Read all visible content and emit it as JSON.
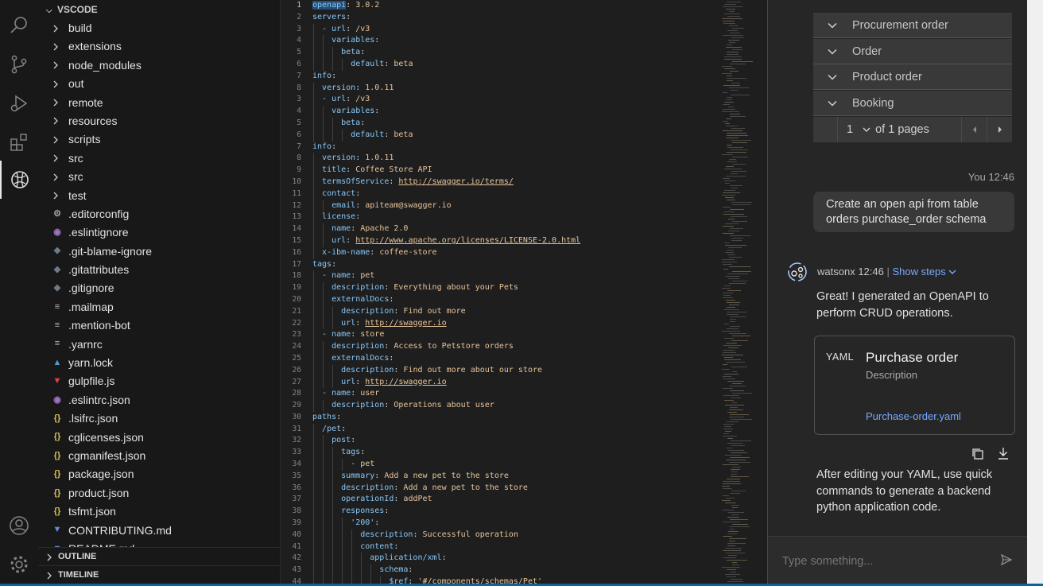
{
  "explorer": {
    "root_label": "VSCODE",
    "items": [
      {
        "type": "folder",
        "label": "build"
      },
      {
        "type": "folder",
        "label": "extensions"
      },
      {
        "type": "folder",
        "label": "node_modules"
      },
      {
        "type": "folder",
        "label": "out"
      },
      {
        "type": "folder",
        "label": "remote"
      },
      {
        "type": "folder",
        "label": "resources"
      },
      {
        "type": "folder",
        "label": "scripts"
      },
      {
        "type": "folder",
        "label": "src"
      },
      {
        "type": "folder",
        "label": "src"
      },
      {
        "type": "folder",
        "label": "test"
      },
      {
        "type": "file",
        "icon": "gear-icon",
        "color": "#9aa0a6",
        "glyph": "⚙",
        "label": ".editorconfig"
      },
      {
        "type": "file",
        "icon": "eslint-icon",
        "color": "#a074c4",
        "glyph": "◉",
        "label": ".eslintignore"
      },
      {
        "type": "file",
        "icon": "git-icon",
        "color": "#6d7a8a",
        "glyph": "◆",
        "label": ".git-blame-ignore"
      },
      {
        "type": "file",
        "icon": "git-icon",
        "color": "#6d7a8a",
        "glyph": "◆",
        "label": ".gitattributes"
      },
      {
        "type": "file",
        "icon": "git-icon",
        "color": "#6d7a8a",
        "glyph": "◆",
        "label": ".gitignore"
      },
      {
        "type": "file",
        "icon": "lines-icon",
        "color": "#aeb4bc",
        "glyph": "≡",
        "label": ".mailmap"
      },
      {
        "type": "file",
        "icon": "lines-icon",
        "color": "#aeb4bc",
        "glyph": "≡",
        "label": ".mention-bot"
      },
      {
        "type": "file",
        "icon": "lines-icon",
        "color": "#aeb4bc",
        "glyph": "≡",
        "label": ".yarnrc"
      },
      {
        "type": "file",
        "icon": "yarn-icon",
        "color": "#4b9fd6",
        "glyph": "▲",
        "label": "yarn.lock"
      },
      {
        "type": "file",
        "icon": "gulp-icon",
        "color": "#e0443e",
        "glyph": "▼",
        "label": "gulpfile.js"
      },
      {
        "type": "file",
        "icon": "eslint-icon",
        "color": "#a074c4",
        "glyph": "◉",
        "label": ".eslintrc.json"
      },
      {
        "type": "file",
        "icon": "json-icon",
        "color": "#d8c05a",
        "glyph": "{}",
        "label": ".lsifrc.json"
      },
      {
        "type": "file",
        "icon": "json-icon",
        "color": "#d8c05a",
        "glyph": "{}",
        "label": "cglicenses.json"
      },
      {
        "type": "file",
        "icon": "json-icon",
        "color": "#d8c05a",
        "glyph": "{}",
        "label": "cgmanifest.json"
      },
      {
        "type": "file",
        "icon": "json-icon",
        "color": "#d8c05a",
        "glyph": "{}",
        "label": "package.json"
      },
      {
        "type": "file",
        "icon": "json-icon",
        "color": "#d8c05a",
        "glyph": "{}",
        "label": "product.json"
      },
      {
        "type": "file",
        "icon": "json-icon",
        "color": "#d8c05a",
        "glyph": "{}",
        "label": "tsfmt.json"
      },
      {
        "type": "file",
        "icon": "markdown-icon",
        "color": "#6a8ad6",
        "glyph": "▼",
        "label": "CONTRIBUTING.md"
      },
      {
        "type": "file",
        "icon": "markdown-icon",
        "color": "#6a8ad6",
        "glyph": "▼",
        "label": "README.md"
      }
    ],
    "outline_label": "OUTLINE",
    "timeline_label": "TIMELINE"
  },
  "editor": {
    "lines": [
      {
        "n": "1",
        "t": "openapi: 3.0.2"
      },
      {
        "n": "2",
        "t": "servers:"
      },
      {
        "n": "3",
        "t": "  - url: /v3"
      },
      {
        "n": "4",
        "t": "    variables:"
      },
      {
        "n": "5",
        "t": "      beta:"
      },
      {
        "n": "6",
        "t": "        default: beta"
      },
      {
        "n": "7",
        "t": "info:"
      },
      {
        "n": "8",
        "t": "  version: 1.0.11"
      },
      {
        "n": "3",
        "t": "  - url: /v3"
      },
      {
        "n": "4",
        "t": "    variables:"
      },
      {
        "n": "5",
        "t": "      beta:"
      },
      {
        "n": "6",
        "t": "        default: beta"
      },
      {
        "n": "7",
        "t": "info:"
      },
      {
        "n": "8",
        "t": "  version: 1.0.11"
      },
      {
        "n": "9",
        "t": "  title: Coffee Store API"
      },
      {
        "n": "10",
        "t": "  termsOfService: http://swagger.io/terms/"
      },
      {
        "n": "11",
        "t": "  contact:"
      },
      {
        "n": "12",
        "t": "    email: apiteam@swagger.io"
      },
      {
        "n": "13",
        "t": "  license:"
      },
      {
        "n": "14",
        "t": "    name: Apache 2.0"
      },
      {
        "n": "15",
        "t": "    url: http://www.apache.org/licenses/LICENSE-2.0.html"
      },
      {
        "n": "16",
        "t": "  x-ibm-name: coffee-store"
      },
      {
        "n": "17",
        "t": "tags:"
      },
      {
        "n": "18",
        "t": "  - name: pet"
      },
      {
        "n": "19",
        "t": "    description: Everything about your Pets"
      },
      {
        "n": "20",
        "t": "    externalDocs:"
      },
      {
        "n": "21",
        "t": "      description: Find out more"
      },
      {
        "n": "22",
        "t": "      url: http://swagger.io"
      },
      {
        "n": "23",
        "t": "  - name: store"
      },
      {
        "n": "24",
        "t": "    description: Access to Petstore orders"
      },
      {
        "n": "25",
        "t": "    externalDocs:"
      },
      {
        "n": "26",
        "t": "      description: Find out more about our store"
      },
      {
        "n": "27",
        "t": "      url: http://swagger.io"
      },
      {
        "n": "28",
        "t": "  - name: user"
      },
      {
        "n": "29",
        "t": "    description: Operations about user"
      },
      {
        "n": "30",
        "t": "paths:"
      },
      {
        "n": "31",
        "t": "  /pet:"
      },
      {
        "n": "32",
        "t": "    post:"
      },
      {
        "n": "33",
        "t": "      tags:"
      },
      {
        "n": "34",
        "t": "        - pet"
      },
      {
        "n": "35",
        "t": "      summary: Add a new pet to the store"
      },
      {
        "n": "36",
        "t": "      description: Add a new pet to the store"
      },
      {
        "n": "37",
        "t": "      operationId: addPet"
      },
      {
        "n": "38",
        "t": "      responses:"
      },
      {
        "n": "39",
        "t": "        '200':"
      },
      {
        "n": "40",
        "t": "          description: Successful operation"
      },
      {
        "n": "41",
        "t": "          content:"
      },
      {
        "n": "42",
        "t": "            application/xml:"
      },
      {
        "n": "43",
        "t": "              schema:"
      },
      {
        "n": "44",
        "t": "                $ref: '#/components/schemas/Pet'"
      }
    ]
  },
  "chat": {
    "accordion": [
      "Procurement order",
      "Order",
      "Product order",
      "Booking"
    ],
    "pager": {
      "page": "1",
      "of_label": "of 1 pages"
    },
    "user_meta": "You 12:46",
    "user_message": "Create an open api from table orders purchase_order schema",
    "bot_name": "watsonx",
    "bot_time": "12:46",
    "show_steps": "Show steps",
    "bot_message": "Great! I generated an OpenAPI to perform CRUD operations.",
    "card": {
      "tag": "YAML",
      "title": "Purchase order",
      "subtitle": "Description",
      "link": "Purchase-order.yaml"
    },
    "followup": "After editing your YAML, use quick commands to generate a backend python application code.",
    "input_placeholder": "Type something..."
  },
  "colors": {
    "link": "#78a9ff",
    "accent_bar": "#0e639c"
  }
}
